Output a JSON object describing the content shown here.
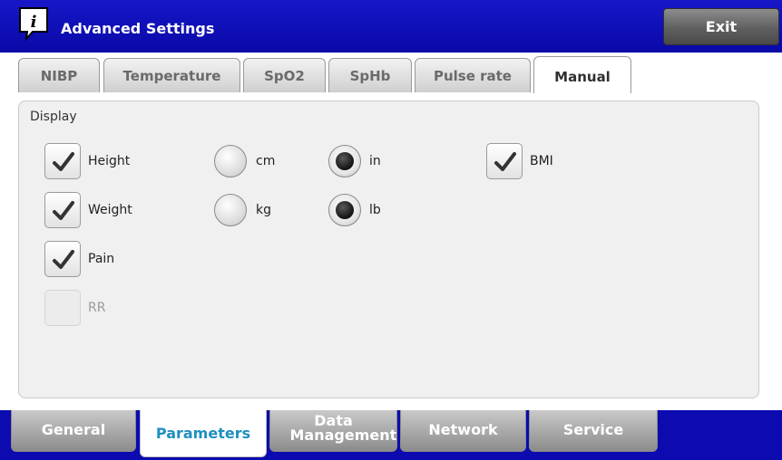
{
  "header": {
    "title": "Advanced Settings",
    "exit_label": "Exit"
  },
  "top_tabs": [
    {
      "label": "NIBP",
      "active": false
    },
    {
      "label": "Temperature",
      "active": false
    },
    {
      "label": "SpO2",
      "active": false
    },
    {
      "label": "SpHb",
      "active": false
    },
    {
      "label": "Pulse rate",
      "active": false
    },
    {
      "label": "Manual",
      "active": true
    }
  ],
  "display": {
    "legend": "Display",
    "height": {
      "label": "Height",
      "checked": true,
      "units": [
        {
          "label": "cm",
          "selected": false
        },
        {
          "label": "in",
          "selected": true
        }
      ]
    },
    "weight": {
      "label": "Weight",
      "checked": true,
      "units": [
        {
          "label": "kg",
          "selected": false
        },
        {
          "label": "lb",
          "selected": true
        }
      ]
    },
    "pain": {
      "label": "Pain",
      "checked": true
    },
    "rr": {
      "label": "RR",
      "checked": false,
      "disabled": true
    },
    "bmi": {
      "label": "BMI",
      "checked": true
    }
  },
  "bottom_tabs": [
    {
      "label": "General",
      "active": false
    },
    {
      "label": "Parameters",
      "active": true
    },
    {
      "label": "Data Management",
      "active": false
    },
    {
      "label": "Network",
      "active": false
    },
    {
      "label": "Service",
      "active": false
    }
  ]
}
